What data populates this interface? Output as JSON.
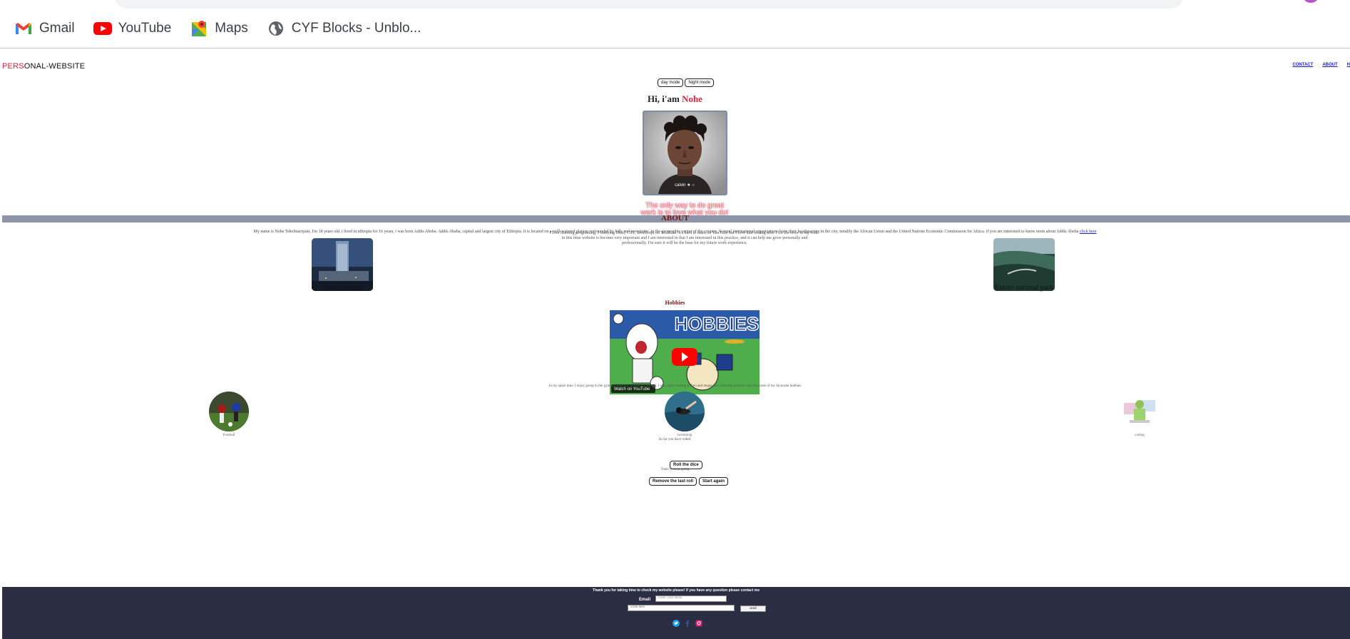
{
  "bookmarks": [
    {
      "label": "Gmail",
      "icon": "gmail-icon"
    },
    {
      "label": "YouTube",
      "icon": "youtube-icon"
    },
    {
      "label": "Maps",
      "icon": "maps-icon"
    },
    {
      "label": "CYF Blocks - Unblo...",
      "icon": "globe-icon"
    }
  ],
  "site": {
    "logo_red": "PERS",
    "logo_rest": "ONAL-WEBSITE",
    "nav": [
      "CONTACT",
      "ABOUT",
      "H"
    ]
  },
  "modes": {
    "day": "day mode",
    "night": "Night mode"
  },
  "hero": {
    "greeting": "Hi, i'am ",
    "name": "Nohe",
    "portrait_caption": "calvin ★ ○",
    "quote": "The only way to do great work is to love what you do!",
    "intro": "I love learning programing. I studying Html, CSS, JavaScript on YouTube. it's hard to learn on YouTube but I love that feeling after I fix the error in my code. in this time website is become very important and I am interested in that I am interested in this practice, and it can help me grow personally and professionally. I'm sure it will be the base for my future work experience."
  },
  "about": {
    "title": "ABOUT",
    "text": "My name is Nohe Tekelmariyam, I'm 18 years old. i lived in ethiopia for 16 years, i was born Addis Abeba. Addis Ababa, capital and largest city of Ethiopia. It is located on a well-watered plateau surrounded by hills and mountains, in the geographic center of the country. Several international organizations have their headquarters in the city, notably the African Union and the United Nations Economic Commission for Africa. if you are interested to know more about Addis Abeba ",
    "link": "click here",
    "photos": [
      {
        "caption": "Africa union"
      },
      {
        "caption": "Entoto national park"
      }
    ]
  },
  "hobbies": {
    "title": "Hobbies",
    "video_title": "HOBBIES",
    "video_watermark": "Watch on YouTube",
    "text": "In my spare time, I enjoy going to the gym and meeting up with my friends. I also enjoy reading fiction and magazines, listening podcast. here are some of my favourite hobbies",
    "items": [
      {
        "caption": "Football"
      },
      {
        "caption": "swimming"
      },
      {
        "caption": "coding"
      }
    ]
  },
  "dice": {
    "rolled": "So far you have rolled:",
    "roll_button": "Roll the dice",
    "total": "Total: 0. keep going",
    "remove_button": "Remove the last roll",
    "start_button": "Start again"
  },
  "footer": {
    "title": "Thank you for taking time to check my website please! if you have any question please contact me",
    "email_label": "Email",
    "email_placeholder": "Enter your email",
    "message_value": "write here",
    "send_label": "send"
  },
  "colors": {
    "accent": "#d6243c",
    "about_bar": "#8d96a8",
    "footer_bg": "#2b2d42",
    "link": "#1a1adb"
  }
}
